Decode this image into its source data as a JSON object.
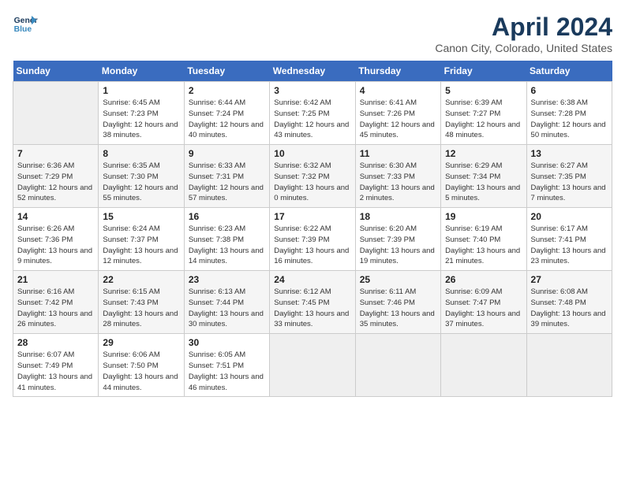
{
  "header": {
    "logo_line1": "General",
    "logo_line2": "Blue",
    "title": "April 2024",
    "subtitle": "Canon City, Colorado, United States"
  },
  "weekdays": [
    "Sunday",
    "Monday",
    "Tuesday",
    "Wednesday",
    "Thursday",
    "Friday",
    "Saturday"
  ],
  "weeks": [
    [
      {
        "day": "",
        "sunrise": "",
        "sunset": "",
        "daylight": ""
      },
      {
        "day": "1",
        "sunrise": "Sunrise: 6:45 AM",
        "sunset": "Sunset: 7:23 PM",
        "daylight": "Daylight: 12 hours and 38 minutes."
      },
      {
        "day": "2",
        "sunrise": "Sunrise: 6:44 AM",
        "sunset": "Sunset: 7:24 PM",
        "daylight": "Daylight: 12 hours and 40 minutes."
      },
      {
        "day": "3",
        "sunrise": "Sunrise: 6:42 AM",
        "sunset": "Sunset: 7:25 PM",
        "daylight": "Daylight: 12 hours and 43 minutes."
      },
      {
        "day": "4",
        "sunrise": "Sunrise: 6:41 AM",
        "sunset": "Sunset: 7:26 PM",
        "daylight": "Daylight: 12 hours and 45 minutes."
      },
      {
        "day": "5",
        "sunrise": "Sunrise: 6:39 AM",
        "sunset": "Sunset: 7:27 PM",
        "daylight": "Daylight: 12 hours and 48 minutes."
      },
      {
        "day": "6",
        "sunrise": "Sunrise: 6:38 AM",
        "sunset": "Sunset: 7:28 PM",
        "daylight": "Daylight: 12 hours and 50 minutes."
      }
    ],
    [
      {
        "day": "7",
        "sunrise": "Sunrise: 6:36 AM",
        "sunset": "Sunset: 7:29 PM",
        "daylight": "Daylight: 12 hours and 52 minutes."
      },
      {
        "day": "8",
        "sunrise": "Sunrise: 6:35 AM",
        "sunset": "Sunset: 7:30 PM",
        "daylight": "Daylight: 12 hours and 55 minutes."
      },
      {
        "day": "9",
        "sunrise": "Sunrise: 6:33 AM",
        "sunset": "Sunset: 7:31 PM",
        "daylight": "Daylight: 12 hours and 57 minutes."
      },
      {
        "day": "10",
        "sunrise": "Sunrise: 6:32 AM",
        "sunset": "Sunset: 7:32 PM",
        "daylight": "Daylight: 13 hours and 0 minutes."
      },
      {
        "day": "11",
        "sunrise": "Sunrise: 6:30 AM",
        "sunset": "Sunset: 7:33 PM",
        "daylight": "Daylight: 13 hours and 2 minutes."
      },
      {
        "day": "12",
        "sunrise": "Sunrise: 6:29 AM",
        "sunset": "Sunset: 7:34 PM",
        "daylight": "Daylight: 13 hours and 5 minutes."
      },
      {
        "day": "13",
        "sunrise": "Sunrise: 6:27 AM",
        "sunset": "Sunset: 7:35 PM",
        "daylight": "Daylight: 13 hours and 7 minutes."
      }
    ],
    [
      {
        "day": "14",
        "sunrise": "Sunrise: 6:26 AM",
        "sunset": "Sunset: 7:36 PM",
        "daylight": "Daylight: 13 hours and 9 minutes."
      },
      {
        "day": "15",
        "sunrise": "Sunrise: 6:24 AM",
        "sunset": "Sunset: 7:37 PM",
        "daylight": "Daylight: 13 hours and 12 minutes."
      },
      {
        "day": "16",
        "sunrise": "Sunrise: 6:23 AM",
        "sunset": "Sunset: 7:38 PM",
        "daylight": "Daylight: 13 hours and 14 minutes."
      },
      {
        "day": "17",
        "sunrise": "Sunrise: 6:22 AM",
        "sunset": "Sunset: 7:39 PM",
        "daylight": "Daylight: 13 hours and 16 minutes."
      },
      {
        "day": "18",
        "sunrise": "Sunrise: 6:20 AM",
        "sunset": "Sunset: 7:39 PM",
        "daylight": "Daylight: 13 hours and 19 minutes."
      },
      {
        "day": "19",
        "sunrise": "Sunrise: 6:19 AM",
        "sunset": "Sunset: 7:40 PM",
        "daylight": "Daylight: 13 hours and 21 minutes."
      },
      {
        "day": "20",
        "sunrise": "Sunrise: 6:17 AM",
        "sunset": "Sunset: 7:41 PM",
        "daylight": "Daylight: 13 hours and 23 minutes."
      }
    ],
    [
      {
        "day": "21",
        "sunrise": "Sunrise: 6:16 AM",
        "sunset": "Sunset: 7:42 PM",
        "daylight": "Daylight: 13 hours and 26 minutes."
      },
      {
        "day": "22",
        "sunrise": "Sunrise: 6:15 AM",
        "sunset": "Sunset: 7:43 PM",
        "daylight": "Daylight: 13 hours and 28 minutes."
      },
      {
        "day": "23",
        "sunrise": "Sunrise: 6:13 AM",
        "sunset": "Sunset: 7:44 PM",
        "daylight": "Daylight: 13 hours and 30 minutes."
      },
      {
        "day": "24",
        "sunrise": "Sunrise: 6:12 AM",
        "sunset": "Sunset: 7:45 PM",
        "daylight": "Daylight: 13 hours and 33 minutes."
      },
      {
        "day": "25",
        "sunrise": "Sunrise: 6:11 AM",
        "sunset": "Sunset: 7:46 PM",
        "daylight": "Daylight: 13 hours and 35 minutes."
      },
      {
        "day": "26",
        "sunrise": "Sunrise: 6:09 AM",
        "sunset": "Sunset: 7:47 PM",
        "daylight": "Daylight: 13 hours and 37 minutes."
      },
      {
        "day": "27",
        "sunrise": "Sunrise: 6:08 AM",
        "sunset": "Sunset: 7:48 PM",
        "daylight": "Daylight: 13 hours and 39 minutes."
      }
    ],
    [
      {
        "day": "28",
        "sunrise": "Sunrise: 6:07 AM",
        "sunset": "Sunset: 7:49 PM",
        "daylight": "Daylight: 13 hours and 41 minutes."
      },
      {
        "day": "29",
        "sunrise": "Sunrise: 6:06 AM",
        "sunset": "Sunset: 7:50 PM",
        "daylight": "Daylight: 13 hours and 44 minutes."
      },
      {
        "day": "30",
        "sunrise": "Sunrise: 6:05 AM",
        "sunset": "Sunset: 7:51 PM",
        "daylight": "Daylight: 13 hours and 46 minutes."
      },
      {
        "day": "",
        "sunrise": "",
        "sunset": "",
        "daylight": ""
      },
      {
        "day": "",
        "sunrise": "",
        "sunset": "",
        "daylight": ""
      },
      {
        "day": "",
        "sunrise": "",
        "sunset": "",
        "daylight": ""
      },
      {
        "day": "",
        "sunrise": "",
        "sunset": "",
        "daylight": ""
      }
    ]
  ]
}
